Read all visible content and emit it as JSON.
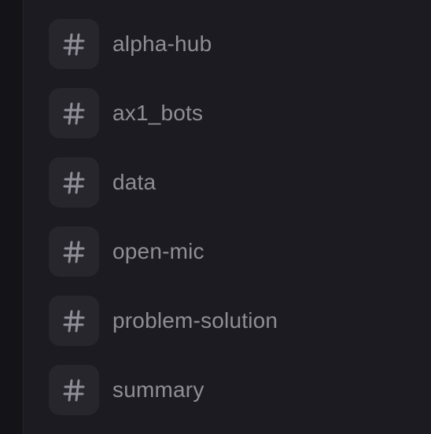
{
  "sidebar": {
    "channels": [
      {
        "label": "alpha-hub",
        "icon": "hash-icon"
      },
      {
        "label": "ax1_bots",
        "icon": "hash-icon"
      },
      {
        "label": "data",
        "icon": "hash-icon"
      },
      {
        "label": "open-mic",
        "icon": "hash-icon"
      },
      {
        "label": "problem-solution",
        "icon": "hash-icon"
      },
      {
        "label": "summary",
        "icon": "hash-icon"
      }
    ]
  },
  "colors": {
    "background": "#1c1b21",
    "rail": "#141317",
    "icon_tile": "#27262d",
    "text": "#8f8e96"
  }
}
